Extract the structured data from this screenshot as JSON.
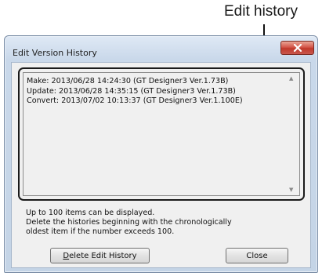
{
  "callout": {
    "label": "Edit history"
  },
  "dialog": {
    "title": "Edit Version History",
    "close_icon": "close-x-icon",
    "history": [
      "Make: 2013/06/28 14:24:30 (GT Designer3 Ver.1.73B)",
      "Update: 2013/06/28 14:35:15 (GT Designer3 Ver.1.73B)",
      "Convert: 2013/07/02 10:13:37 (GT Designer3 Ver.1.100E)"
    ],
    "info": [
      "Up to 100 items can be displayed.",
      "Delete the histories beginning with the chronologically",
      "oldest item if the number exceeds 100."
    ],
    "buttons": {
      "delete_mnemonic": "D",
      "delete_rest": "elete Edit History",
      "close": "Close"
    }
  },
  "colors": {
    "title_close": "#c0392b",
    "frame": "#c4d4e6",
    "client": "#f0f0f0"
  }
}
